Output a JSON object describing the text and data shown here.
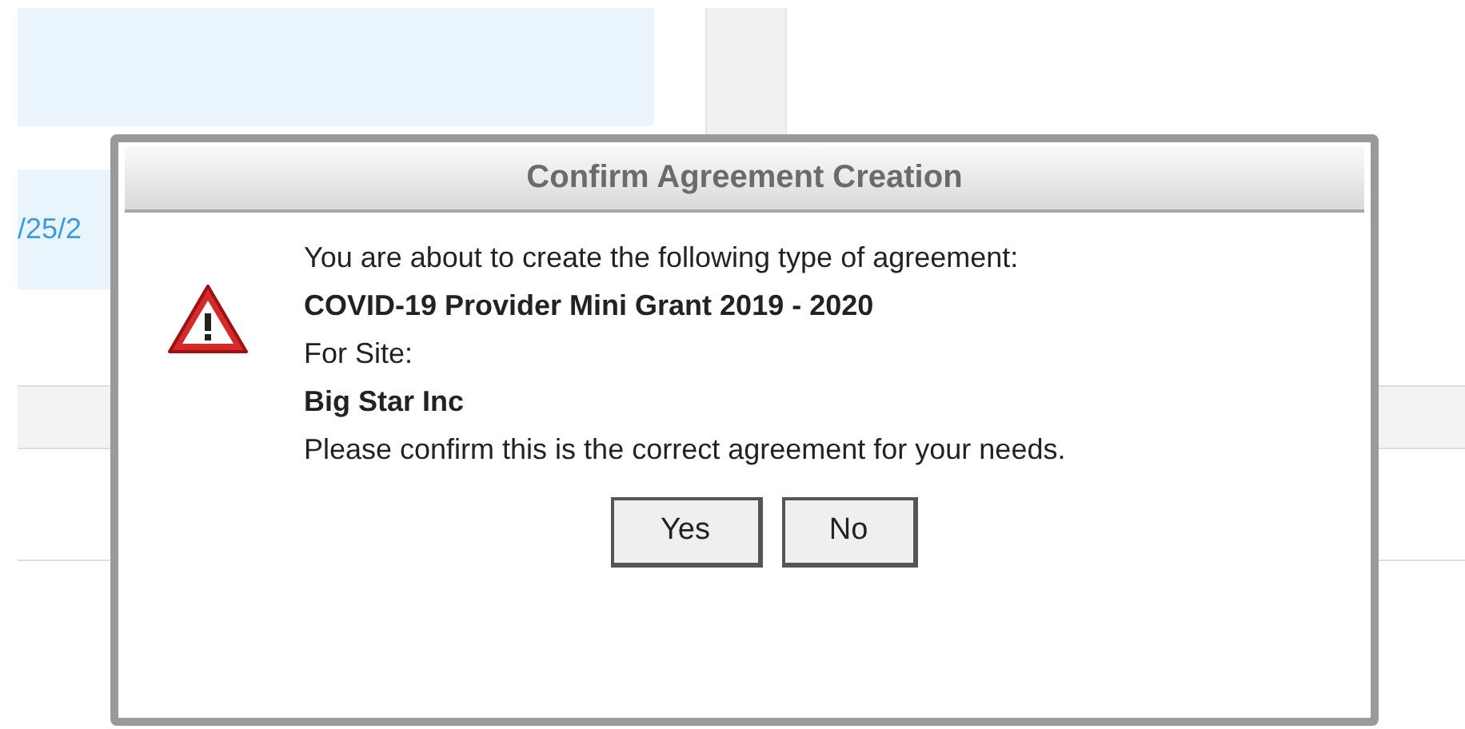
{
  "background": {
    "date_fragment": "/25/2"
  },
  "dialog": {
    "title": "Confirm Agreement Creation",
    "lines": [
      {
        "text": "You are about to create the following type of agreement:",
        "kind": "plain"
      },
      {
        "text": "COVID-19 Provider Mini Grant 2019 - 2020",
        "kind": "bold"
      },
      {
        "text": "For Site:",
        "kind": "plain"
      },
      {
        "text": "Big Star Inc",
        "kind": "bold"
      },
      {
        "text": "Please confirm this is the correct agreement for your needs.",
        "kind": "plain"
      }
    ],
    "buttons": [
      "Yes",
      "No"
    ]
  }
}
